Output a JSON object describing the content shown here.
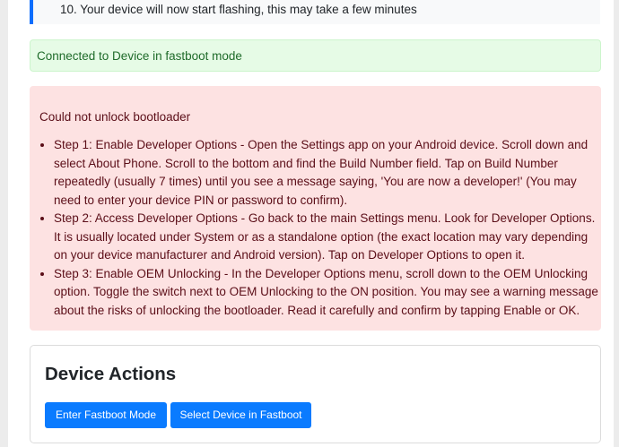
{
  "flash_steps": {
    "step_text": "10. Your device will now start flashing, this may take a few minutes"
  },
  "status": {
    "connected": "Connected to Device in fastboot mode"
  },
  "error": {
    "title": "Could not unlock bootloader",
    "steps": [
      "Step 1: Enable Developer Options - Open the Settings app on your Android device. Scroll down and select About Phone. Scroll to the bottom and find the Build Number field. Tap on Build Number repeatedly (usually 7 times) until you see a message saying, 'You are now a developer!' (You may need to enter your device PIN or password to confirm).",
      "Step 2: Access Developer Options - Go back to the main Settings menu. Look for Developer Options. It is usually located under System or as a standalone option (the exact location may vary depending on your device manufacturer and Android version). Tap on Developer Options to open it.",
      "Step 3: Enable OEM Unlocking - In the Developer Options menu, scroll down to the OEM Unlocking option. Toggle the switch next to OEM Unlocking to the ON position. You may see a warning message about the risks of unlocking the bootloader. Read it carefully and confirm by tapping Enable or OK."
    ]
  },
  "device_actions": {
    "title": "Device Actions",
    "buttons": {
      "enter_fastboot": "Enter Fastboot Mode",
      "select_device": "Select Device in Fastboot"
    }
  },
  "colors": {
    "primary_button": "#0a7bff",
    "success_background": "#e6fbe6",
    "error_background": "#fde2e2",
    "step_accent": "#0d6efd"
  }
}
